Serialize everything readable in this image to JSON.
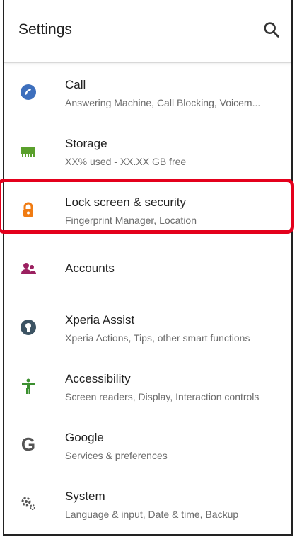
{
  "header": {
    "title": "Settings",
    "search_icon": "search-icon"
  },
  "items": [
    {
      "id": "call",
      "title": "Call",
      "subtitle": "Answering Machine, Call Blocking, Voicem...",
      "icon": "phone-icon",
      "icon_color": "#3d6fbd"
    },
    {
      "id": "storage",
      "title": "Storage",
      "subtitle": "XX% used - XX.XX GB free",
      "icon": "storage-icon",
      "icon_color": "#5aa02c"
    },
    {
      "id": "lock",
      "title": "Lock screen & security",
      "subtitle": "Fingerprint Manager, Location",
      "icon": "lock-icon",
      "icon_color": "#f07b12"
    },
    {
      "id": "accounts",
      "title": "Accounts",
      "subtitle": "",
      "icon": "accounts-icon",
      "icon_color": "#9b2060"
    },
    {
      "id": "xperia",
      "title": "Xperia Assist",
      "subtitle": "Xperia Actions, Tips, other smart functions",
      "icon": "lightbulb-icon",
      "icon_color": "#3c5363"
    },
    {
      "id": "accessibility",
      "title": "Accessibility",
      "subtitle": "Screen readers, Display, Interaction controls",
      "icon": "accessibility-icon",
      "icon_color": "#3b8f2f"
    },
    {
      "id": "google",
      "title": "Google",
      "subtitle": "Services & preferences",
      "icon": "google-icon",
      "icon_color": "#555555"
    },
    {
      "id": "system",
      "title": "System",
      "subtitle": "Language & input, Date & time, Backup",
      "icon": "gear-icon",
      "icon_color": "#555555"
    }
  ],
  "highlight": {
    "target": "accounts",
    "color": "#e4001c"
  }
}
